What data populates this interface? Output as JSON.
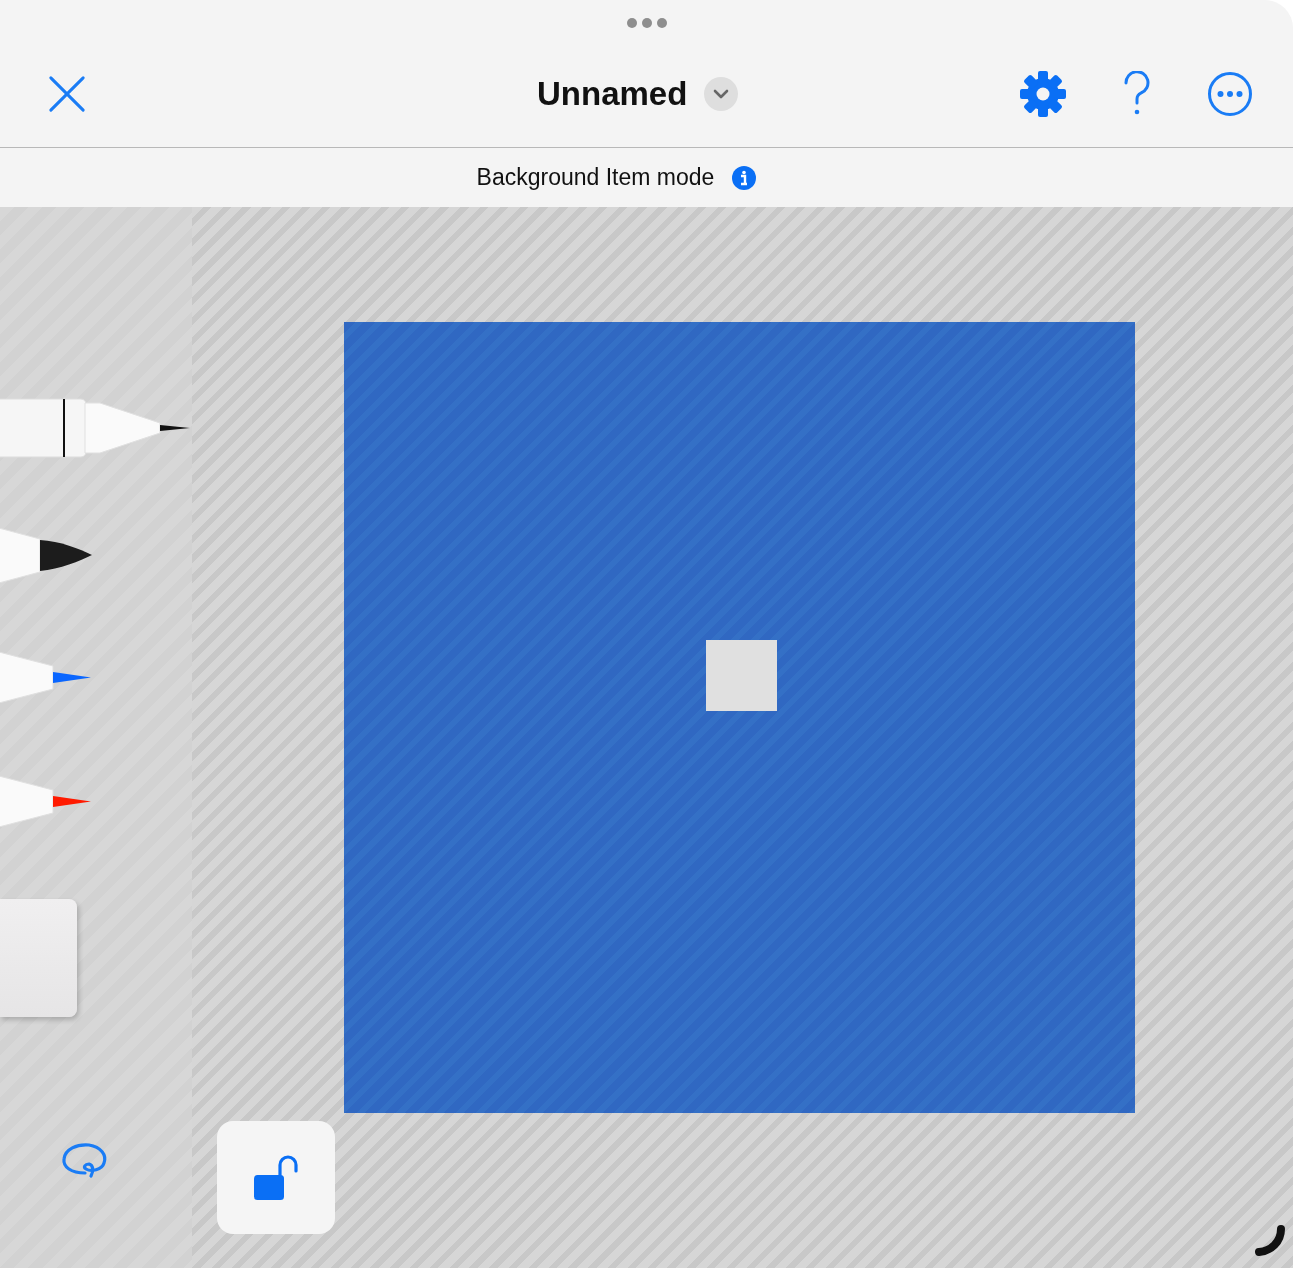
{
  "header": {
    "title": "Unnamed"
  },
  "mode_banner": {
    "text": "Background Item mode"
  },
  "tools": [
    {
      "kind": "fineliner",
      "color": "#111111"
    },
    {
      "kind": "marker",
      "color": "#1c1c1c"
    },
    {
      "kind": "pen",
      "color": "#0a66ff"
    },
    {
      "kind": "pen",
      "color": "#ff1a00"
    },
    {
      "kind": "eraser"
    },
    {
      "kind": "lasso"
    }
  ],
  "canvas": {
    "locked": false
  }
}
